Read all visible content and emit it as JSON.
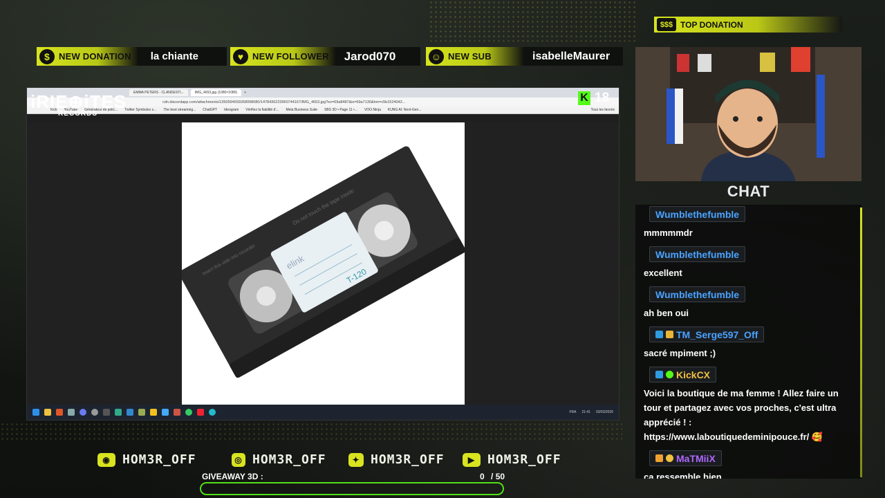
{
  "alerts": {
    "donation": {
      "label": "NEW DONATION",
      "value": "la chiante",
      "icon": "dollar-icon"
    },
    "follower": {
      "label": "NEW FOLLOWER",
      "value": "Jarod070",
      "icon": "heart-icon"
    },
    "sub": {
      "label": "NEW SUB",
      "value": "isabelleMaurer",
      "icon": "sub-icon"
    }
  },
  "top_donation": {
    "label": "TOP DONATION",
    "icon": "dollar-stack-icon"
  },
  "logo": {
    "text": "iRIE⊕iTES",
    "sub": "RECORDS"
  },
  "kick": {
    "viewers": "18"
  },
  "browser": {
    "tabs": [
      "EMMA PETERS - CLANDESTI...",
      "IMG_4653.jpg (1080×1080)"
    ],
    "url": "cdn.discordapp.com/attachments/1350594559268098080/1478436223960744167/IMG_4653.jpg?ex=69a8487&is=69a7130&hm=c5b1524042...",
    "bookmarks": [
      "Kick",
      "YouTube",
      "Générateur de polic...",
      "Twitter Symbolez s...",
      "The best streaming...",
      "ChatGPT",
      "Ideogram",
      "Vérifiez la fiabilité d'...",
      "Meta Business Suite",
      "SBS 3D • Page 11 •...",
      "VOO.Ninja",
      "KUNG AI: Next-Gen...",
      "Tous les favoris"
    ]
  },
  "cassette": {
    "brand": "elink",
    "model": "T-120",
    "hint_top": "Do not touch the tape inside",
    "hint_side": "Insert this side into recorder"
  },
  "taskbar": {
    "lang": "FRA",
    "time": "21:41",
    "date": "03/03/2026"
  },
  "chat": {
    "title": "CHAT",
    "messages": [
      {
        "user": "Wumblethefumble",
        "color": "#4aa3ff",
        "text": "mmmmmdr",
        "badges": []
      },
      {
        "user": "Wumblethefumble",
        "color": "#4aa3ff",
        "text": "excellent",
        "badges": []
      },
      {
        "user": "Wumblethefumble",
        "color": "#4aa3ff",
        "text": "ah ben oui",
        "badges": []
      },
      {
        "user": "TM_Serge597_Off",
        "color": "#4aa3ff",
        "text": "sacré mpiment ;)",
        "badges": [
          "#2f9be0",
          "#e8b43a"
        ]
      },
      {
        "user": "KickCX",
        "color": "#f0c040",
        "text": "Voici la boutique de ma femme ! Allez faire un tour et partagez avec vos proches, c'est ultra apprécié ! : https://www.laboutiquedeminipouce.fr/ 🥰",
        "badges": [
          "#2f9be0",
          "#53fc18"
        ]
      },
      {
        "user": "MaTMiiX",
        "color": "#b067ff",
        "text": "ça ressemble bien",
        "badges": [
          "#f0a030",
          "#f0c040"
        ]
      }
    ]
  },
  "socials": [
    {
      "icon": "discord-icon",
      "handle": "HOM3R_OFF"
    },
    {
      "icon": "instagram-icon",
      "handle": "HOM3R_OFF"
    },
    {
      "icon": "twitter-icon",
      "handle": "HOM3R_OFF"
    },
    {
      "icon": "youtube-icon",
      "handle": "HOM3R_OFF"
    }
  ],
  "giveaway": {
    "label": "GIVEAWAY 3D :",
    "current": "0",
    "total": "/ 50",
    "progress": 0.0
  },
  "colors": {
    "accent": "#d7e41f",
    "kick": "#53fc18",
    "user_blue": "#4aa3ff",
    "user_purple": "#b067ff",
    "user_gold": "#f0c040"
  }
}
